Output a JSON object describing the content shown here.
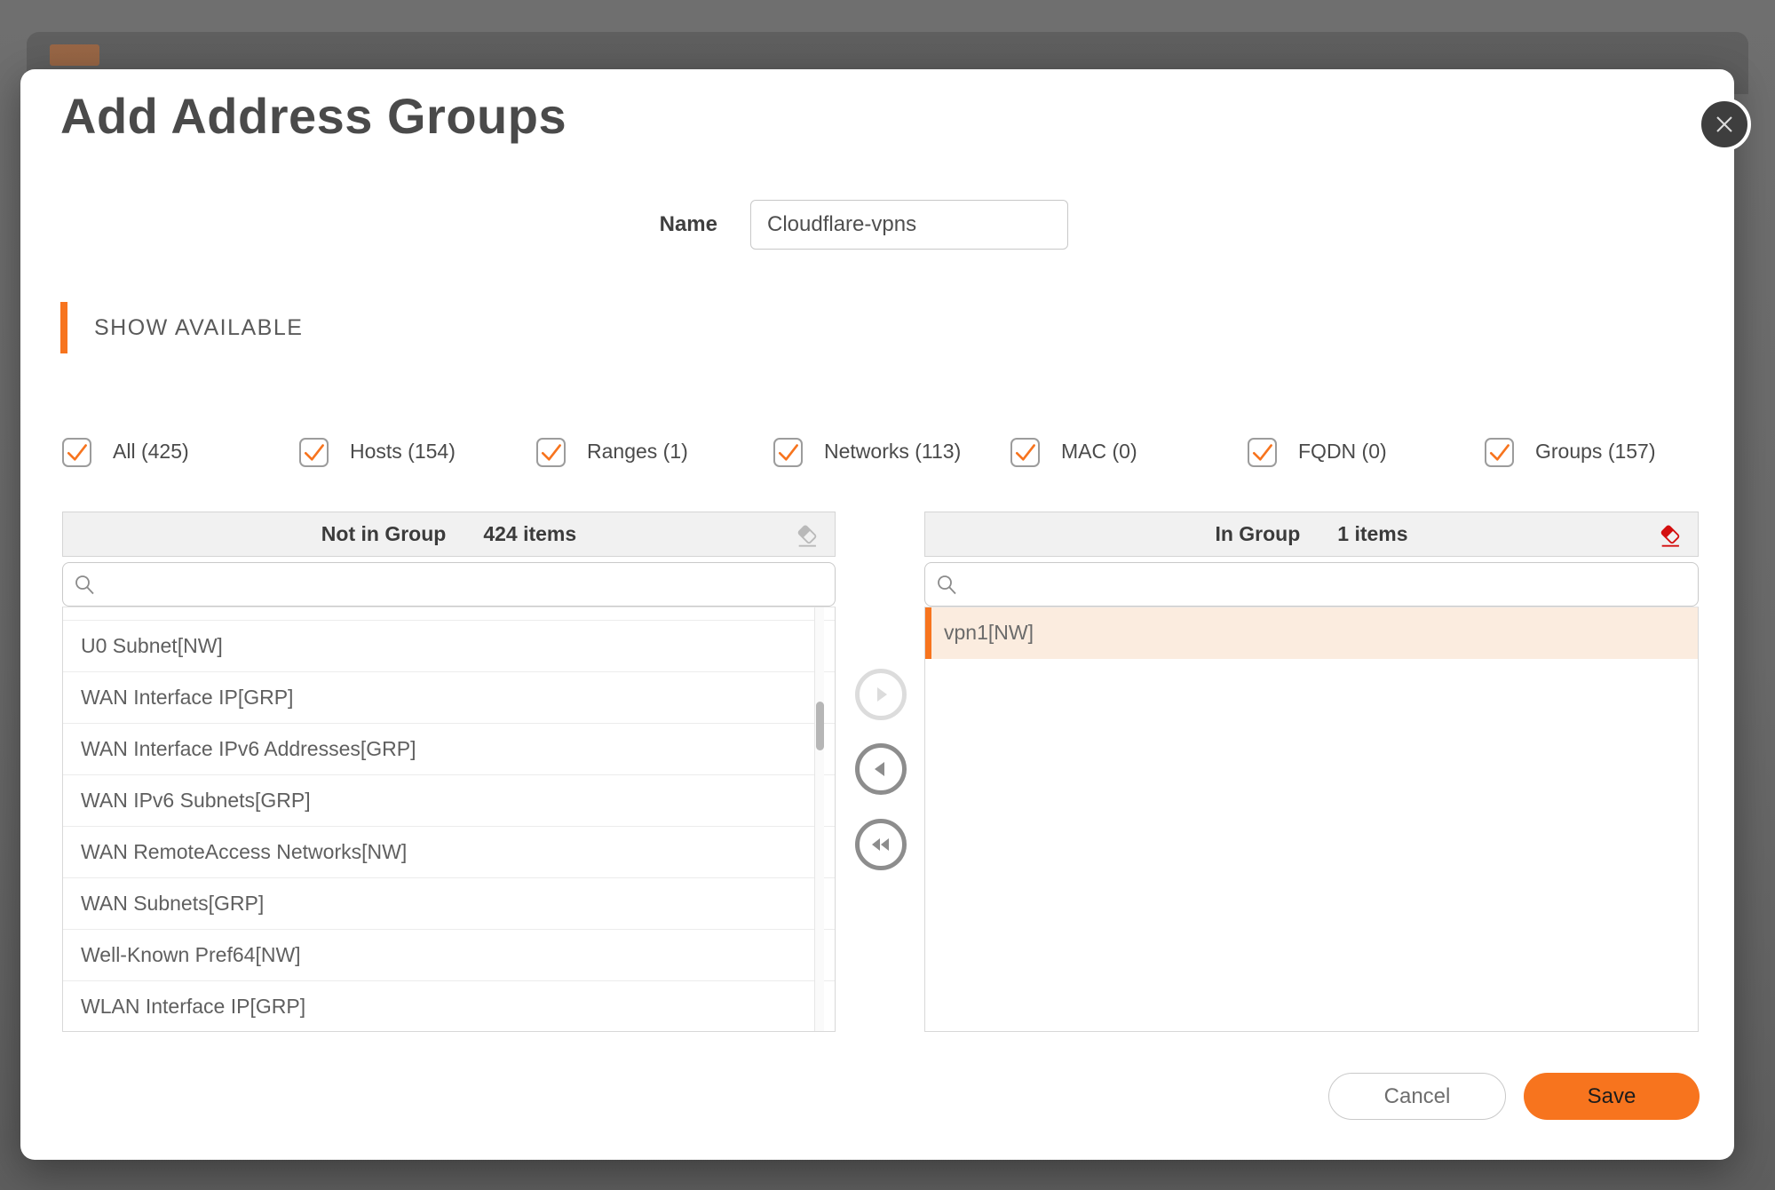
{
  "modal": {
    "title": "Add Address Groups",
    "name_field": {
      "label": "Name",
      "value": "Cloudflare-vpns"
    },
    "section_header": "SHOW AVAILABLE",
    "filters": [
      {
        "label": "All (425)",
        "checked": true
      },
      {
        "label": "Hosts (154)",
        "checked": true
      },
      {
        "label": "Ranges (1)",
        "checked": true
      },
      {
        "label": "Networks (113)",
        "checked": true
      },
      {
        "label": "MAC (0)",
        "checked": true
      },
      {
        "label": "FQDN (0)",
        "checked": true
      },
      {
        "label": "Groups (157)",
        "checked": true
      }
    ],
    "left_panel": {
      "title": "Not in Group",
      "count": "424 items",
      "search_placeholder": "",
      "items": [
        "U0 Subnet[NW]",
        "WAN Interface IP[GRP]",
        "WAN Interface IPv6 Addresses[GRP]",
        "WAN IPv6 Subnets[GRP]",
        "WAN RemoteAccess Networks[NW]",
        "WAN Subnets[GRP]",
        "Well-Known Pref64[NW]",
        "WLAN Interface IP[GRP]"
      ]
    },
    "right_panel": {
      "title": "In Group",
      "count": "1 items",
      "search_placeholder": "",
      "items": [
        "vpn1[NW]"
      ],
      "selected_index": 0
    },
    "transfer": {
      "move_right_enabled": false,
      "move_left_enabled": true,
      "move_all_left_enabled": true
    },
    "footer": {
      "cancel_label": "Cancel",
      "save_label": "Save"
    }
  },
  "colors": {
    "accent": "#F7741E",
    "eraser_red": "#D40F0F",
    "eraser_grey": "#B9B9B9",
    "selected_row_bg": "#FBECDF"
  }
}
